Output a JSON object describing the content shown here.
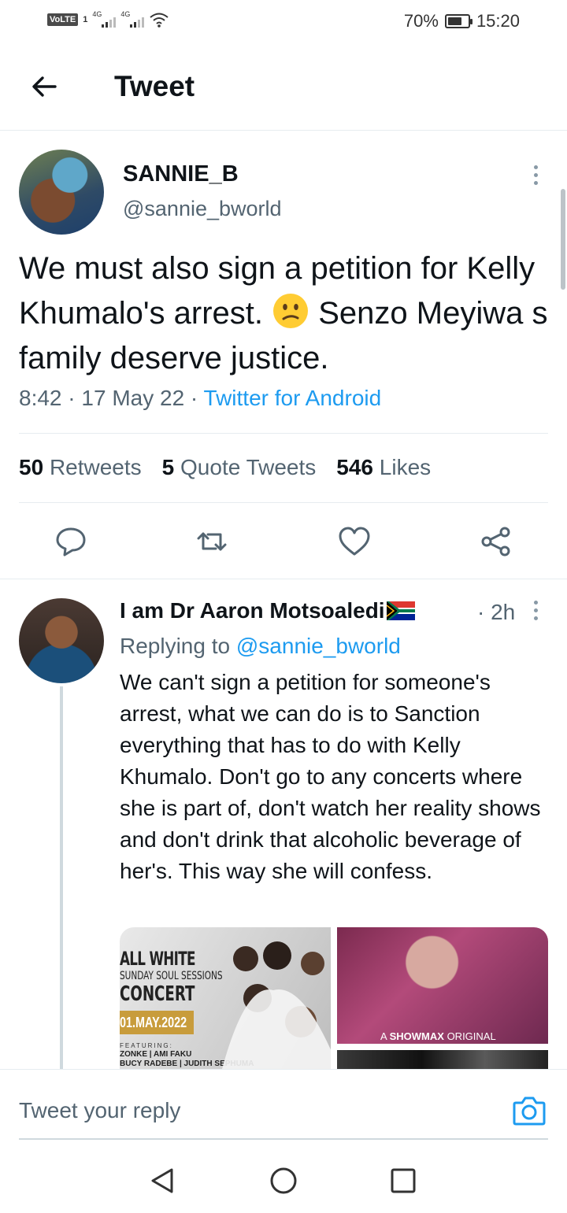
{
  "status_bar": {
    "volte": "VoLTE",
    "sim": "1",
    "net1": "4G",
    "net2": "4G",
    "battery": "70%",
    "battery_level": 0.7,
    "time": "15:20"
  },
  "header": {
    "title": "Tweet"
  },
  "main_tweet": {
    "name": "SANNIE_B",
    "handle": "@sannie_bworld",
    "text_before_emoji": "We must also sign a petition for Kelly Khumalo's arrest.",
    "emoji": "confused-face",
    "text_after_emoji": "Senzo Meyiwa s family deserve justice.",
    "time": "8:42",
    "date": "17 May 22",
    "source": "Twitter for Android",
    "stats": {
      "retweets_count": "50",
      "retweets_label": "Retweets",
      "quotes_count": "5",
      "quotes_label": "Quote Tweets",
      "likes_count": "546",
      "likes_label": "Likes"
    }
  },
  "reply": {
    "name": "I am Dr Aaron Motsoaledi",
    "flag": "south-africa-flag",
    "time": "· 2h",
    "replying_prefix": "Replying to",
    "replying_handle": "@sannie_bworld",
    "text": "We can't sign a petition for someone's arrest, what we can do is to Sanction everything that has to do with Kelly Khumalo. Don't go to any concerts where she is part of, don't watch her reality shows and don't drink that alcoholic beverage of her's. This way she will confess.",
    "media": {
      "poster_line1": "ALL WHITE",
      "poster_line2": "SUNDAY SOUL SESSIONS",
      "poster_line3": "CONCERT",
      "poster_date": "01.MAY.2022",
      "poster_featuring": "FEATURING:",
      "poster_names1": "ZONKE | AMI FAKU",
      "poster_names2": "BUCY RADEBE | JUDITH SEPHUMA",
      "showmax_prefix": "A",
      "showmax_brand": "SHOWMAX",
      "showmax_suffix": "ORIGINAL"
    }
  },
  "reply_bar": {
    "placeholder": "Tweet your reply"
  },
  "colors": {
    "accent": "#1d9bf0",
    "secondary_text": "#536471",
    "divider": "#e6ecf0"
  }
}
